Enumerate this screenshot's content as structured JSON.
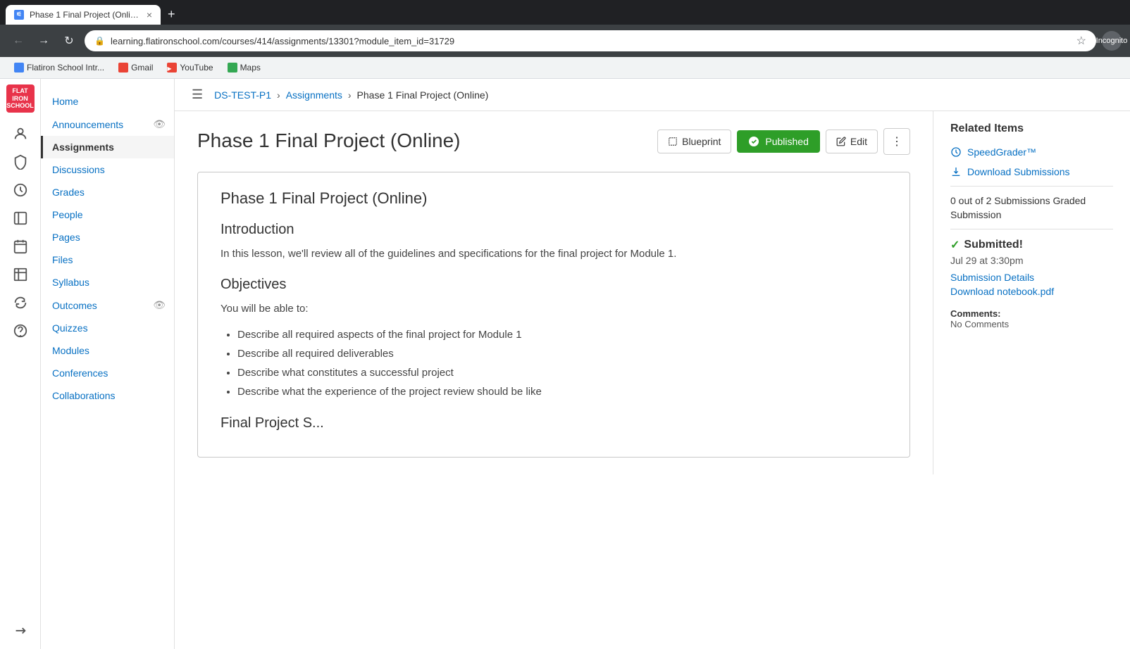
{
  "browser": {
    "tab_title": "Phase 1 Final Project (Online)",
    "tab_close": "×",
    "url_full": "learning.flatironschool.com/courses/414/assignments/13301?module_item_id=31729",
    "url_display": "learning.flatironschool.com/courses/414/assignments/13301?module_item_id=31729",
    "profile_label": "Incognito",
    "nav_back": "←",
    "nav_forward": "→",
    "nav_reload": "↻"
  },
  "bookmarks": [
    {
      "id": "flatiron",
      "label": "Flatiron School Intr...",
      "color": "bm-blue"
    },
    {
      "id": "gmail",
      "label": "Gmail",
      "color": "bm-red"
    },
    {
      "id": "youtube",
      "label": "YouTube",
      "color": "bm-red"
    },
    {
      "id": "maps",
      "label": "Maps",
      "color": "bm-green"
    }
  ],
  "breadcrumb": {
    "course": "DS-TEST-P1",
    "section": "Assignments",
    "current": "Phase 1 Final Project (Online)"
  },
  "nav_sidebar": {
    "items": [
      {
        "id": "home",
        "label": "Home",
        "active": false
      },
      {
        "id": "announcements",
        "label": "Announcements",
        "has_eye": true,
        "active": false
      },
      {
        "id": "assignments",
        "label": "Assignments",
        "active": true
      },
      {
        "id": "discussions",
        "label": "Discussions",
        "active": false
      },
      {
        "id": "grades",
        "label": "Grades",
        "active": false
      },
      {
        "id": "people",
        "label": "People",
        "active": false
      },
      {
        "id": "pages",
        "label": "Pages",
        "active": false
      },
      {
        "id": "files",
        "label": "Files",
        "active": false
      },
      {
        "id": "syllabus",
        "label": "Syllabus",
        "active": false
      },
      {
        "id": "outcomes",
        "label": "Outcomes",
        "has_eye": true,
        "active": false
      },
      {
        "id": "quizzes",
        "label": "Quizzes",
        "active": false
      },
      {
        "id": "modules",
        "label": "Modules",
        "active": false
      },
      {
        "id": "conferences",
        "label": "Conferences",
        "active": false
      },
      {
        "id": "collaborations",
        "label": "Collaborations",
        "active": false
      }
    ]
  },
  "assignment": {
    "title": "Phase 1 Final Project (Online)",
    "actions": {
      "blueprint_label": "Blueprint",
      "published_label": "Published",
      "edit_label": "Edit",
      "more_label": "⋮"
    },
    "content": {
      "title": "Phase 1 Final Project (Online)",
      "intro_heading": "Introduction",
      "intro_text": "In this lesson, we'll review all of the guidelines and specifications for the final project for Module 1.",
      "objectives_heading": "Objectives",
      "objectives_intro": "You will be able to:",
      "objectives_list": [
        "Describe all required aspects of the final project for Module 1",
        "Describe all required deliverables",
        "Describe what constitutes a successful project",
        "Describe what the experience of the project review should be like"
      ],
      "final_section": "Final Project S..."
    }
  },
  "right_sidebar": {
    "title": "Related Items",
    "speedgrader_label": "SpeedGrader™",
    "download_label": "Download Submissions",
    "submissions_text": "0 out of 2 Submissions Graded",
    "submission_label": "Submission",
    "submitted_label": "Submitted!",
    "submitted_time": "Jul 29 at 3:30pm",
    "submission_details_label": "Submission Details",
    "download_notebook_label": "Download notebook.pdf",
    "comments_label": "Comments:",
    "comments_none": "No Comments"
  }
}
